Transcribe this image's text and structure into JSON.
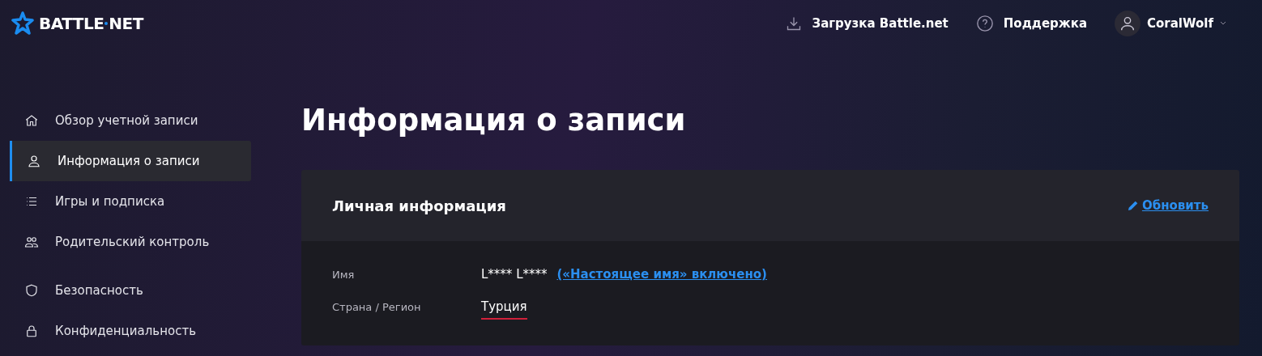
{
  "header": {
    "logo": {
      "left": "BATTLE",
      "right": "NET"
    },
    "links": [
      {
        "label": "Загрузка Battle.net"
      },
      {
        "label": "Поддержка"
      }
    ],
    "user": {
      "name": "CoralWolf"
    }
  },
  "sidebar": {
    "groups": [
      [
        {
          "label": "Обзор учетной записи",
          "selected": false
        },
        {
          "label": "Информация о записи",
          "selected": true
        },
        {
          "label": "Игры и подписка",
          "selected": false
        },
        {
          "label": "Родительский контроль",
          "selected": false
        }
      ],
      [
        {
          "label": "Безопасность",
          "selected": false
        },
        {
          "label": "Конфиденциальность",
          "selected": false
        }
      ]
    ]
  },
  "page": {
    "title": "Информация о записи",
    "card": {
      "title": "Личная информация",
      "action": "Обновить",
      "fields": [
        {
          "label": "Имя",
          "value": "L**** L****",
          "link": "(«Настоящее имя» включено)",
          "marked": false
        },
        {
          "label": "Страна / Регион",
          "value": "Турция",
          "marked": true
        }
      ]
    }
  }
}
